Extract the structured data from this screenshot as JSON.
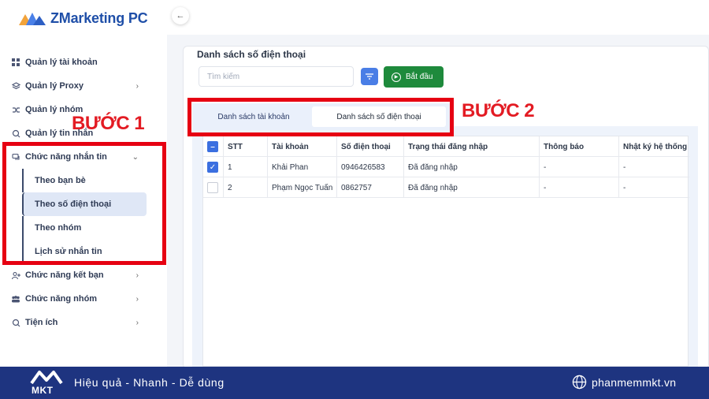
{
  "app": {
    "title": "ZMarketing PC"
  },
  "sidebar": {
    "items": [
      {
        "label": "Quản lý tài khoản",
        "icon": "grid-icon"
      },
      {
        "label": "Quản lý Proxy",
        "icon": "layers-icon",
        "chevron": "›"
      },
      {
        "label": "Quản lý nhóm",
        "icon": "shuffle-icon"
      },
      {
        "label": "Quản lý tin nhắn",
        "icon": "search-message-icon"
      },
      {
        "label": "Chức năng nhắn tin",
        "icon": "chat-icon",
        "chevron": "⌄"
      },
      {
        "label": "Chức năng kết bạn",
        "icon": "user-add-icon",
        "chevron": "›"
      },
      {
        "label": "Chức năng nhóm",
        "icon": "users-icon",
        "chevron": "›"
      },
      {
        "label": "Tiện ích",
        "icon": "search-icon",
        "chevron": "›"
      }
    ],
    "subitems": [
      {
        "label": "Theo bạn bè"
      },
      {
        "label": "Theo số điện thoại",
        "active": true
      },
      {
        "label": "Theo nhóm"
      },
      {
        "label": "Lịch sử nhắn tin"
      }
    ]
  },
  "annotations": {
    "step1": "BƯỚC 1",
    "step2": "BƯỚC 2",
    "box_color": "#e60012"
  },
  "main": {
    "panel_title": "Danh sách số điện thoại",
    "search_placeholder": "Tìm kiếm",
    "start_button": "Bắt đầu",
    "tabs": [
      {
        "label": "Danh sách tài khoản"
      },
      {
        "label": "Danh sách số điện thoại",
        "active": true
      }
    ],
    "table": {
      "headers": [
        "STT",
        "Tài khoản",
        "Số điện thoại",
        "Trạng thái đăng nhập",
        "Thông báo",
        "Nhật ký hệ thống"
      ],
      "rows": [
        {
          "checked": true,
          "cells": [
            "1",
            "Khải Phan",
            "0946426583",
            "Đã đăng nhập",
            "-",
            "-"
          ]
        },
        {
          "checked": false,
          "cells": [
            "2",
            "Phạm Ngọc Tuấn",
            "0862757",
            "Đã đăng nhập",
            "-",
            "-"
          ]
        }
      ]
    }
  },
  "footer": {
    "brand": "MKT",
    "slogan": "Hiệu quả - Nhanh - Dễ dùng",
    "website": "phanmemmkt.vn"
  },
  "colors": {
    "accent": "#3b6fe0",
    "start_green": "#1e8a3c",
    "footer_bg": "#1e3480"
  }
}
